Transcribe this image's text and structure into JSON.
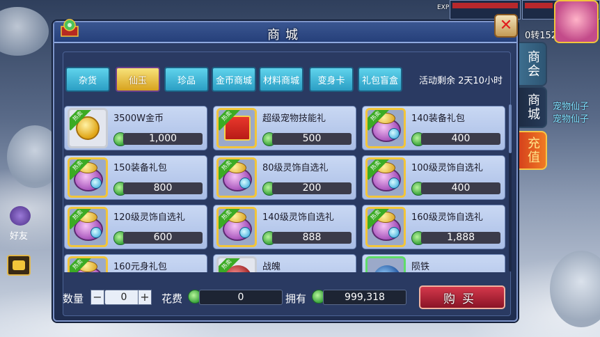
{
  "window": {
    "title": "商城",
    "close_icon": "close-icon"
  },
  "side_tabs": {
    "guild": "商会",
    "shop": "商城",
    "recharge": "充值"
  },
  "hud": {
    "left_text": "0转",
    "right_text": "0转152",
    "exp_label": "EXP",
    "pet_label_1": "宠物仙子",
    "pet_label_2": "宠物仙子"
  },
  "categories": [
    {
      "label": "杂货",
      "active": false
    },
    {
      "label": "仙玉",
      "active": true
    },
    {
      "label": "珍品",
      "active": false
    },
    {
      "label": "金币商城",
      "active": false
    },
    {
      "label": "材料商城",
      "active": false
    },
    {
      "label": "变身卡",
      "active": false
    },
    {
      "label": "礼包盲盒",
      "active": false
    }
  ],
  "event_remaining": "活动剩余 2天10小时",
  "hot_badge": "热卖",
  "items": [
    {
      "name": "3500W金币",
      "price": "1,000",
      "icon": "gold-coin-icon",
      "hot": true
    },
    {
      "name": "超级宠物技能礼",
      "price": "500",
      "icon": "gift-box-icon",
      "hot": true
    },
    {
      "name": "140装备礼包",
      "price": "400",
      "icon": "gift-bag-icon",
      "hot": true
    },
    {
      "name": "150装备礼包",
      "price": "800",
      "icon": "gift-bag-icon",
      "hot": true
    },
    {
      "name": "80级灵饰自选礼",
      "price": "200",
      "icon": "gift-bag-icon",
      "hot": true
    },
    {
      "name": "100级灵饰自选礼",
      "price": "400",
      "icon": "gift-bag-icon",
      "hot": true
    },
    {
      "name": "120级灵饰自选礼",
      "price": "600",
      "icon": "gift-bag-icon",
      "hot": true
    },
    {
      "name": "140级灵饰自选礼",
      "price": "888",
      "icon": "gift-bag-icon",
      "hot": true
    },
    {
      "name": "160级灵饰自选礼",
      "price": "1,888",
      "icon": "gift-bag-icon",
      "hot": true
    },
    {
      "name": "160元身礼包",
      "price": "",
      "icon": "gift-bag-icon",
      "hot": true
    },
    {
      "name": "战魄",
      "price": "",
      "icon": "red-orb-icon",
      "hot": true
    },
    {
      "name": "陨铁",
      "price": "",
      "icon": "blue-orb-icon",
      "hot": false
    }
  ],
  "bottom": {
    "quantity_label": "数量",
    "quantity_value": "0",
    "minus": "−",
    "plus": "+",
    "cost_label": "花费",
    "cost_value": "0",
    "owned_label": "拥有",
    "owned_value": "999,318",
    "buy_label": "购买"
  },
  "left_hud": {
    "friend_label": "好友",
    "chat_icon": "chat-icon"
  },
  "colors": {
    "active_tab": "#d8a21e",
    "tab": "#2b9ec4",
    "buy": "#8a1426",
    "hot_badge": "#3bab24"
  }
}
